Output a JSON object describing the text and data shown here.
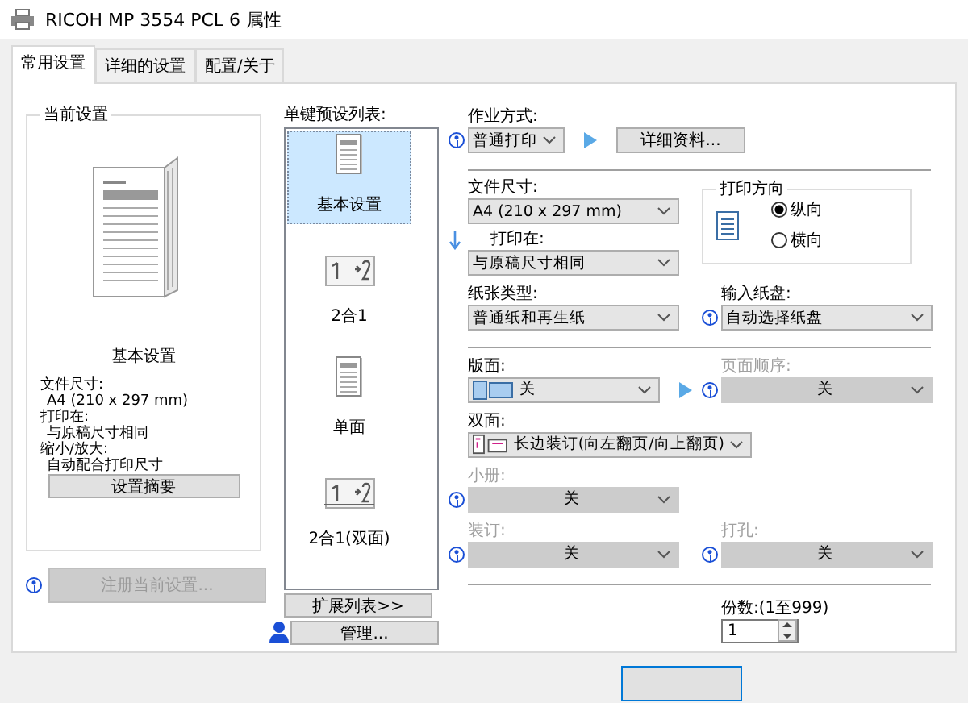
{
  "window": {
    "title": "RICOH MP 3554 PCL 6 属性"
  },
  "tabs": [
    {
      "label": "常用设置",
      "selected": true
    },
    {
      "label": "详细的设置",
      "selected": false
    },
    {
      "label": "配置/关于",
      "selected": false
    }
  ],
  "current_settings": {
    "title": "当前设置",
    "preset_name": "基本设置",
    "details": [
      {
        "label": "文件尺寸:",
        "value": "A4 (210 x 297 mm)"
      },
      {
        "label": "打印在:",
        "value": "与原稿尺寸相同"
      },
      {
        "label": "缩小/放大:",
        "value": "自动配合打印尺寸"
      }
    ],
    "summary_button": "设置摘要",
    "register_button": {
      "label": "注册当前设置...",
      "disabled": true
    }
  },
  "presets": {
    "label": "单键预设列表:",
    "items": [
      {
        "label": "基本设置",
        "kind": "page",
        "selected": true
      },
      {
        "label": "2合1",
        "kind": "two-in-one",
        "selected": false
      },
      {
        "label": "单面",
        "kind": "page",
        "selected": false
      },
      {
        "label": "2合1(双面)",
        "kind": "two-in-one-duplex",
        "selected": false
      }
    ],
    "expand_button": "扩展列表>>",
    "manage_button": "管理..."
  },
  "job_type": {
    "label": "作业方式:",
    "value": "普通打印",
    "details_button": "详细资料..."
  },
  "document_size": {
    "label": "文件尺寸:",
    "value": "A4 (210 x 297 mm)"
  },
  "print_on": {
    "label": "打印在:",
    "value": "与原稿尺寸相同"
  },
  "orientation": {
    "title": "打印方向",
    "options": [
      {
        "label": "纵向",
        "selected": true
      },
      {
        "label": "横向",
        "selected": false
      }
    ]
  },
  "paper_type": {
    "label": "纸张类型:",
    "value": "普通纸和再生纸"
  },
  "input_tray": {
    "label": "输入纸盘:",
    "value": "自动选择纸盘"
  },
  "layout": {
    "label": "版面:",
    "value": "关"
  },
  "page_order": {
    "label": "页面顺序:",
    "value": "关",
    "disabled": true
  },
  "duplex": {
    "label": "双面:",
    "value": "长边装订(向左翻页/向上翻页)"
  },
  "booklet": {
    "label": "小册:",
    "value": "关",
    "disabled": true
  },
  "staple": {
    "label": "装订:",
    "value": "关",
    "disabled": true
  },
  "punch": {
    "label": "打孔:",
    "value": "关",
    "disabled": true
  },
  "copies": {
    "label": "份数:(1至999)",
    "value": "1"
  }
}
